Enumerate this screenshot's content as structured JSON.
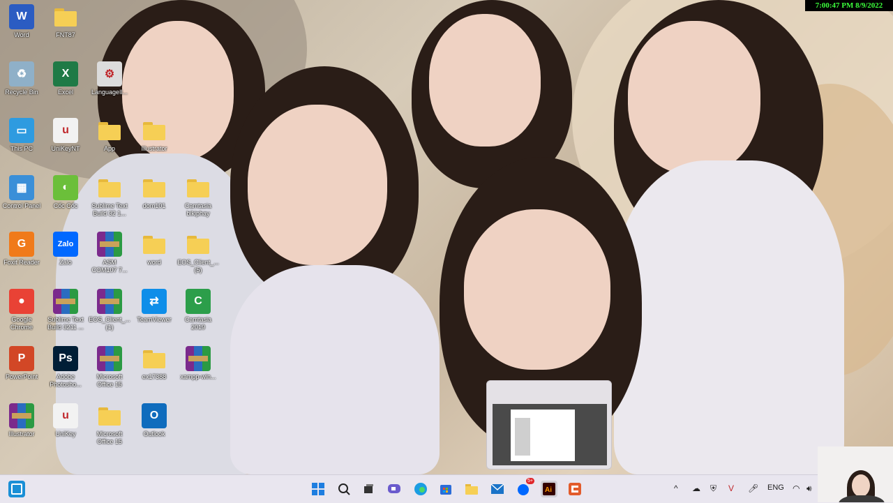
{
  "clock_overlay": "7:00:47 PM 8/9/2022",
  "desktop_icons": [
    {
      "label": "Word",
      "glyph": "W",
      "color": "#2b5cc2"
    },
    {
      "label": "FNT87",
      "glyph": "",
      "color": "#f6cf55"
    },
    {
      "label": "Recycle Bin",
      "glyph": "♻",
      "color": "#8fb0c8"
    },
    {
      "label": "Excel",
      "glyph": "X",
      "color": "#1f7a46"
    },
    {
      "label": "LanguageIl...",
      "glyph": "⚙",
      "color": "#dcdcdc"
    },
    {
      "label": "This PC",
      "glyph": "▭",
      "color": "#2e9be0"
    },
    {
      "label": "UniKeyNT",
      "glyph": "u",
      "color": "#f2f2f2"
    },
    {
      "label": "App",
      "glyph": "",
      "color": "#f6cf55"
    },
    {
      "label": "Illustrator",
      "glyph": "",
      "color": "#f6cf55"
    },
    {
      "label": "Control Panel",
      "glyph": "▦",
      "color": "#3a8fd8"
    },
    {
      "label": "Cốc Cốc",
      "glyph": "◐",
      "color": "#6bbf3a"
    },
    {
      "label": "Sublime Text\nBuild 32 1...",
      "glyph": "",
      "color": "#f6cf55"
    },
    {
      "label": "dom101",
      "glyph": "",
      "color": "#f6cf55"
    },
    {
      "label": "Camtasia\nbikiphay",
      "glyph": "",
      "color": "#f6cf55"
    },
    {
      "label": "Foxit Reader",
      "glyph": "G",
      "color": "#f07a1a"
    },
    {
      "label": "Zalo",
      "glyph": "Zalo",
      "color": "#0068ff"
    },
    {
      "label": "ASM\nCOM107 7...",
      "glyph": "",
      "color": "#7b2a8c"
    },
    {
      "label": "word",
      "glyph": "",
      "color": "#f6cf55"
    },
    {
      "label": "EOS_Client_...\n(5)",
      "glyph": "",
      "color": "#f6cf55"
    },
    {
      "label": "Google\nChrome",
      "glyph": "●",
      "color": "#e94235"
    },
    {
      "label": "Sublime Text\nBuild 3211 ...",
      "glyph": "",
      "color": "#7b2a8c"
    },
    {
      "label": "EOS_Client_...\n(1)",
      "glyph": "",
      "color": "#7b2a8c"
    },
    {
      "label": "TeamViewer",
      "glyph": "⇄",
      "color": "#0e8ee9"
    },
    {
      "label": "Camtasia\n2019",
      "glyph": "C",
      "color": "#2c9e4a"
    },
    {
      "label": "PowerPoint",
      "glyph": "P",
      "color": "#d24726"
    },
    {
      "label": "Adobe\nPhotosho...",
      "glyph": "Ps",
      "color": "#001e36"
    },
    {
      "label": "Microsoft\nOffice 15",
      "glyph": "",
      "color": "#7b2a8c"
    },
    {
      "label": "ex17388",
      "glyph": "",
      "color": "#f6cf55"
    },
    {
      "label": "xampp-win...",
      "glyph": "",
      "color": "#7b2a8c"
    },
    {
      "label": "Illustrator",
      "glyph": "",
      "color": "#7b2a8c"
    },
    {
      "label": "UniKey",
      "glyph": "u",
      "color": "#f2f2f2"
    },
    {
      "label": "Microsoft\nOffice 15",
      "glyph": "",
      "color": "#f6cf55"
    },
    {
      "label": "Outlook",
      "glyph": "O",
      "color": "#0f6cbd"
    }
  ],
  "taskbar": {
    "tray_language": "ENG",
    "badge_zalo": "5+"
  }
}
